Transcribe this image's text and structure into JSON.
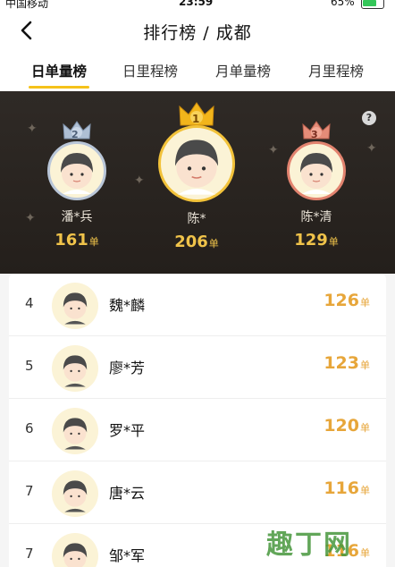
{
  "status": {
    "carrier": "中国移动",
    "time": "23:59",
    "battery": "65%"
  },
  "header": {
    "title": "排行榜 / 成都",
    "back_icon": "chevron-left-icon"
  },
  "tabs": [
    {
      "label": "日单量榜",
      "active": true
    },
    {
      "label": "日里程榜",
      "active": false
    },
    {
      "label": "月单量榜",
      "active": false
    },
    {
      "label": "月里程榜",
      "active": false
    }
  ],
  "podium": {
    "help_label": "?",
    "unit": "单",
    "first": {
      "rank": "1",
      "name": "陈*",
      "count": "206"
    },
    "second": {
      "rank": "2",
      "name": "潘*兵",
      "count": "161"
    },
    "third": {
      "rank": "3",
      "name": "陈*清",
      "count": "129"
    }
  },
  "list": {
    "unit": "单",
    "rows": [
      {
        "rank": "4",
        "name": "魏*麟",
        "count": "126"
      },
      {
        "rank": "5",
        "name": "廖*芳",
        "count": "123"
      },
      {
        "rank": "6",
        "name": "罗*平",
        "count": "120"
      },
      {
        "rank": "7",
        "name": "唐*云",
        "count": "116"
      },
      {
        "rank": "7",
        "name": "邹*军",
        "count": "116"
      }
    ]
  },
  "watermark": "趣丁网",
  "colors": {
    "accent": "#f5c21a",
    "count": "#e7a63a",
    "podium_bg": "#2f2a26"
  }
}
